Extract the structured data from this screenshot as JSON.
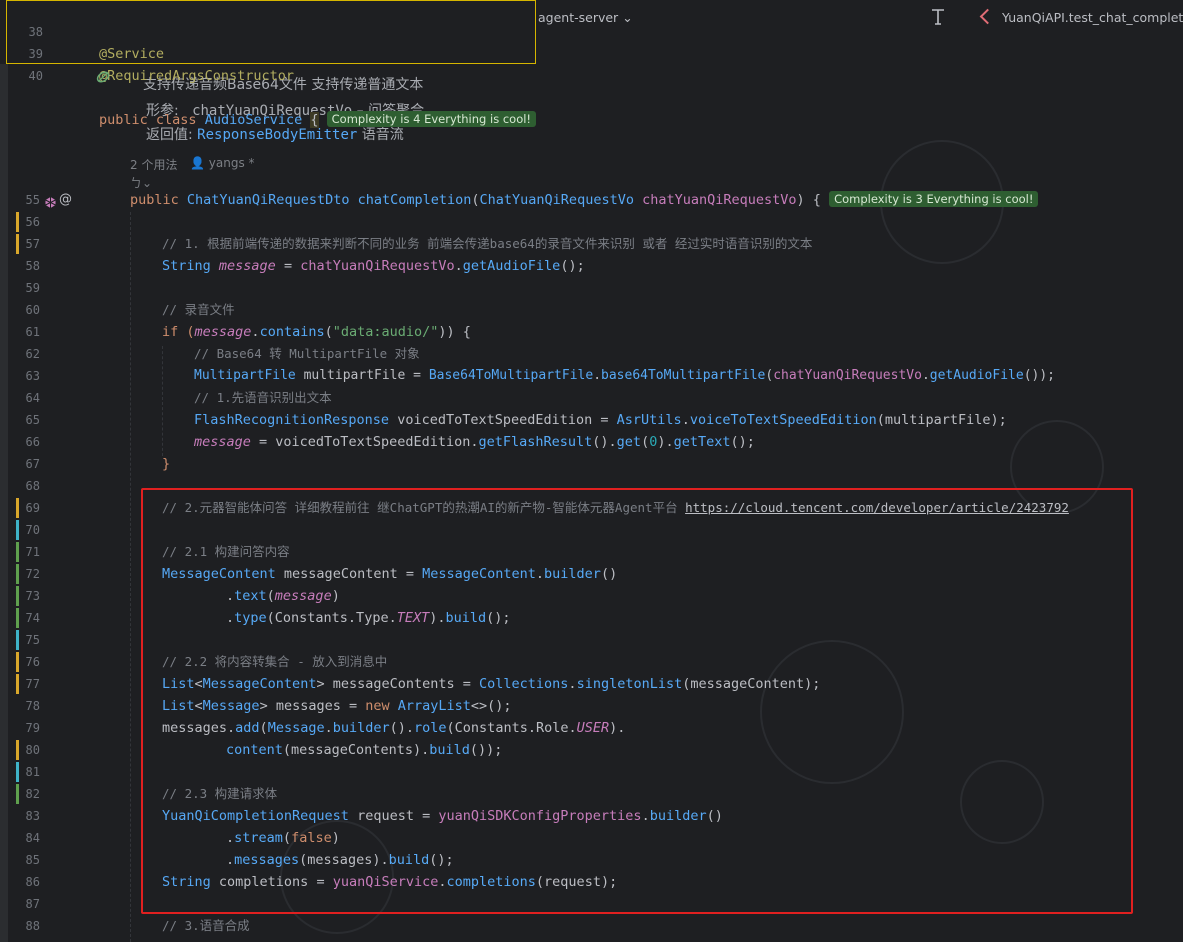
{
  "topbar": {
    "project": "agent-server",
    "run_config": "YuanQiAPI.test_chat_completion"
  },
  "sticky": [
    {
      "no": "38",
      "code": "@Service"
    },
    {
      "no": "39",
      "code": "@RequiredArgsConstructor"
    },
    {
      "no": "40",
      "kw": "public class",
      "name": "AudioService",
      "brace": "{",
      "badge": "Complexity is 4 Everything is cool!"
    }
  ],
  "doc": {
    "summary": "支持传递音频Base64文件 支持传递普通文本",
    "param_label": "形参:",
    "param_name": "chatYuanQiRequestVo",
    "param_desc": " – 问答聚合",
    "return_label": "返回值:",
    "return_type": "ResponseBodyEmitter",
    "return_desc": "语音流"
  },
  "hints": {
    "usages": "2 个用法",
    "author": "yangs *",
    "extra": "ㄅ"
  },
  "badge_method": "Complexity is 3 Everything is cool!",
  "line_numbers": [
    "55",
    "56",
    "57",
    "58",
    "59",
    "60",
    "61",
    "62",
    "63",
    "64",
    "65",
    "66",
    "67",
    "68",
    "69",
    "70",
    "71",
    "72",
    "73",
    "74",
    "75",
    "76",
    "77",
    "78",
    "79",
    "80",
    "81",
    "82",
    "83",
    "84",
    "85",
    "86",
    "87",
    "88"
  ],
  "code": {
    "l55": [
      "public ",
      "ChatYuanQiRequestDto ",
      "chatCompletion",
      "(",
      "ChatYuanQiRequestVo ",
      "chatYuanQiRequestVo",
      ") {"
    ],
    "l57": "// 1. 根据前端传递的数据来判断不同的业务 前端会传递base64的录音文件来识别 或者 经过实时语音识别的文本",
    "l58": [
      "String ",
      "message",
      " = ",
      "chatYuanQiRequestVo",
      ".",
      "getAudioFile",
      "();"
    ],
    "l60": "// 录音文件",
    "l61": [
      "if (",
      "message",
      ".",
      "contains",
      "(",
      "\"data:audio/\"",
      ")) {"
    ],
    "l62": "// Base64 转 MultipartFile 对象",
    "l63": [
      "MultipartFile ",
      "multipartFile = ",
      "Base64ToMultipartFile",
      ".",
      "base64ToMultipartFile",
      "(",
      "chatYuanQiRequestVo",
      ".",
      "getAudioFile",
      "());"
    ],
    "l64": "// 1.先语音识别出文本",
    "l65": [
      "FlashRecognitionResponse ",
      "voicedToTextSpeedEdition = ",
      "AsrUtils",
      ".",
      "voiceToTextSpeedEdition",
      "(multipartFile);"
    ],
    "l66": [
      "message",
      " = voicedToTextSpeedEdition.",
      "getFlashResult",
      "().",
      "get",
      "(",
      "0",
      ").",
      "getText",
      "();"
    ],
    "l67": "}",
    "l69_cmt": "// 2.元器智能体问答 详细教程前往 继ChatGPT的热潮AI的新产物-智能体元器Agent平台 ",
    "l69_link": "https://cloud.tencent.com/developer/article/2423792",
    "l71": "// 2.1 构建问答内容",
    "l72": [
      "MessageContent ",
      "messageContent = ",
      "MessageContent",
      ".",
      "builder",
      "()"
    ],
    "l73": [
      ".",
      "text",
      "(",
      "message",
      ")"
    ],
    "l74": [
      ".",
      "type",
      "(Constants.Type.",
      "TEXT",
      ").",
      "build",
      "();"
    ],
    "l76": "// 2.2 将内容转集合 - 放入到消息中",
    "l77": [
      "List",
      "<",
      "MessageContent",
      "> messageContents = ",
      "Collections",
      ".",
      "singletonList",
      "(messageContent);"
    ],
    "l78": [
      "List",
      "<",
      "Message",
      "> messages = ",
      "new ",
      "ArrayList",
      "<>();"
    ],
    "l79": [
      "messages.",
      "add",
      "(",
      "Message",
      ".",
      "builder",
      "().",
      "role",
      "(Constants.Role.",
      "USER",
      ")."
    ],
    "l80": [
      "content",
      "(messageContents).",
      "build",
      "());"
    ],
    "l82": "// 2.3 构建请求体",
    "l83": [
      "YuanQiCompletionRequest ",
      "request = ",
      "yuanQiSDKConfigProperties",
      ".",
      "builder",
      "()"
    ],
    "l84": [
      ".",
      "stream",
      "(",
      "false",
      ")"
    ],
    "l85": [
      ".",
      "messages",
      "(messages).",
      "build",
      "();"
    ],
    "l86": [
      "String ",
      "completions = ",
      "yuanQiService",
      ".",
      "completions",
      "(request);"
    ],
    "l88": "// 3.语音合成"
  },
  "colors": {
    "vcs_modified": "#d9a72b",
    "vcs_added": "#5fa04e",
    "vcs_cyan": "#3fb3c8",
    "highlight_box": "#e02020"
  }
}
